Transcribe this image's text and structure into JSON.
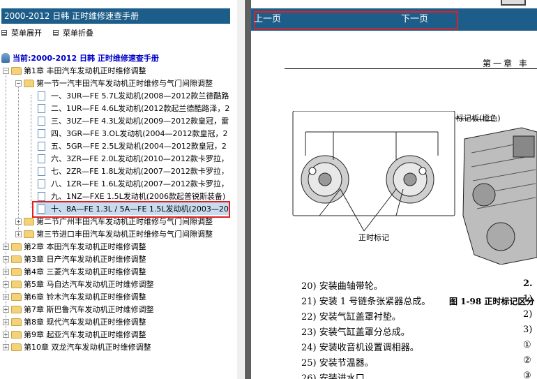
{
  "left": {
    "title": "2000-2012 日韩 正时维修速查手册",
    "menu": {
      "expand_label": "菜单展开",
      "collapse_label": "菜单折叠"
    },
    "tree": {
      "root_label": "当前:2000-2012 日韩 正时维修速查手册",
      "chapter1": "第1章 丰田汽车发动机正时维修调整",
      "section1": "第一节一汽丰田汽车发动机正时维修与气门间隙调整",
      "docs": [
        "一、3UR—FE 5.7L发动机(2008—2012款兰德酷路",
        "二、1UR—FE 4.6L发动机(2012款起兰德酷路泽，2",
        "三、3UZ—FE 4.3L发动机(2009—2012款皇冠，雷",
        "四、3GR—FE 3.OL发动机(2004—2012款皇冠，2",
        "五、5GR—FE 2.5L发动机(2004—2012款皇冠，2",
        "六、3ZR—FE 2.0L发动机(2010—2012款卡罗拉，",
        "七、2ZR—FE 1.8L发动机(2007—2012款卡罗拉，",
        "八、1ZR—FE 1.6L发动机(2007—2012款卡罗拉，",
        "九、1NZ—FXE 1.5L发动机(2006款起普锐斯装备)",
        "十、8A—FE 1.3L / 5A—FE 1.5L发动机(2003—20"
      ],
      "sections_more": [
        "第二节广州丰田汽车发动机正时维修与气门间隙调整",
        "第三节进口丰田汽车发动机正时维修与气门间隙调整"
      ],
      "chapters_more": [
        "第2章 本田汽车发动机正时维修调整",
        "第3章 日产汽车发动机正时维修调整",
        "第4章 三菱汽车发动机正时维修调整",
        "第5章 马自达汽车发动机正时维修调整",
        "第6章 铃木汽车发动机正时维修调整",
        "第7章 斯巴鲁汽车发动机正时维修调整",
        "第8章 现代汽车发动机正时维修调整",
        "第9章 起亚汽车发动机正时维修调整",
        "第10章 双龙汽车发动机正时维修调整"
      ]
    }
  },
  "nav": {
    "prev_label": "上一页",
    "next_label": "下一页"
  },
  "page": {
    "chapter_head": "第一章  丰",
    "fig_label_mark": "标记板(橙色)",
    "fig_label_timing": "正时标记",
    "fig_caption": "图 1-98  正时标记区分",
    "steps": [
      "20) 安装曲轴带轮。",
      "21) 安装 1 号链条张紧器总成。",
      "22) 安装气缸盖罩衬垫。",
      "23) 安装气缸盖罩分总成。",
      "24) 安装收音机设置调相器。",
      "25) 安装节温器。",
      "26) 安装进水口。"
    ],
    "right_col": [
      "2.",
      "1)",
      "2)",
      "3)",
      "①",
      "②",
      "③"
    ]
  },
  "colors": {
    "title_bar": "#1d5d8a",
    "highlight_border": "#e02020",
    "root_text": "#0000c8"
  }
}
